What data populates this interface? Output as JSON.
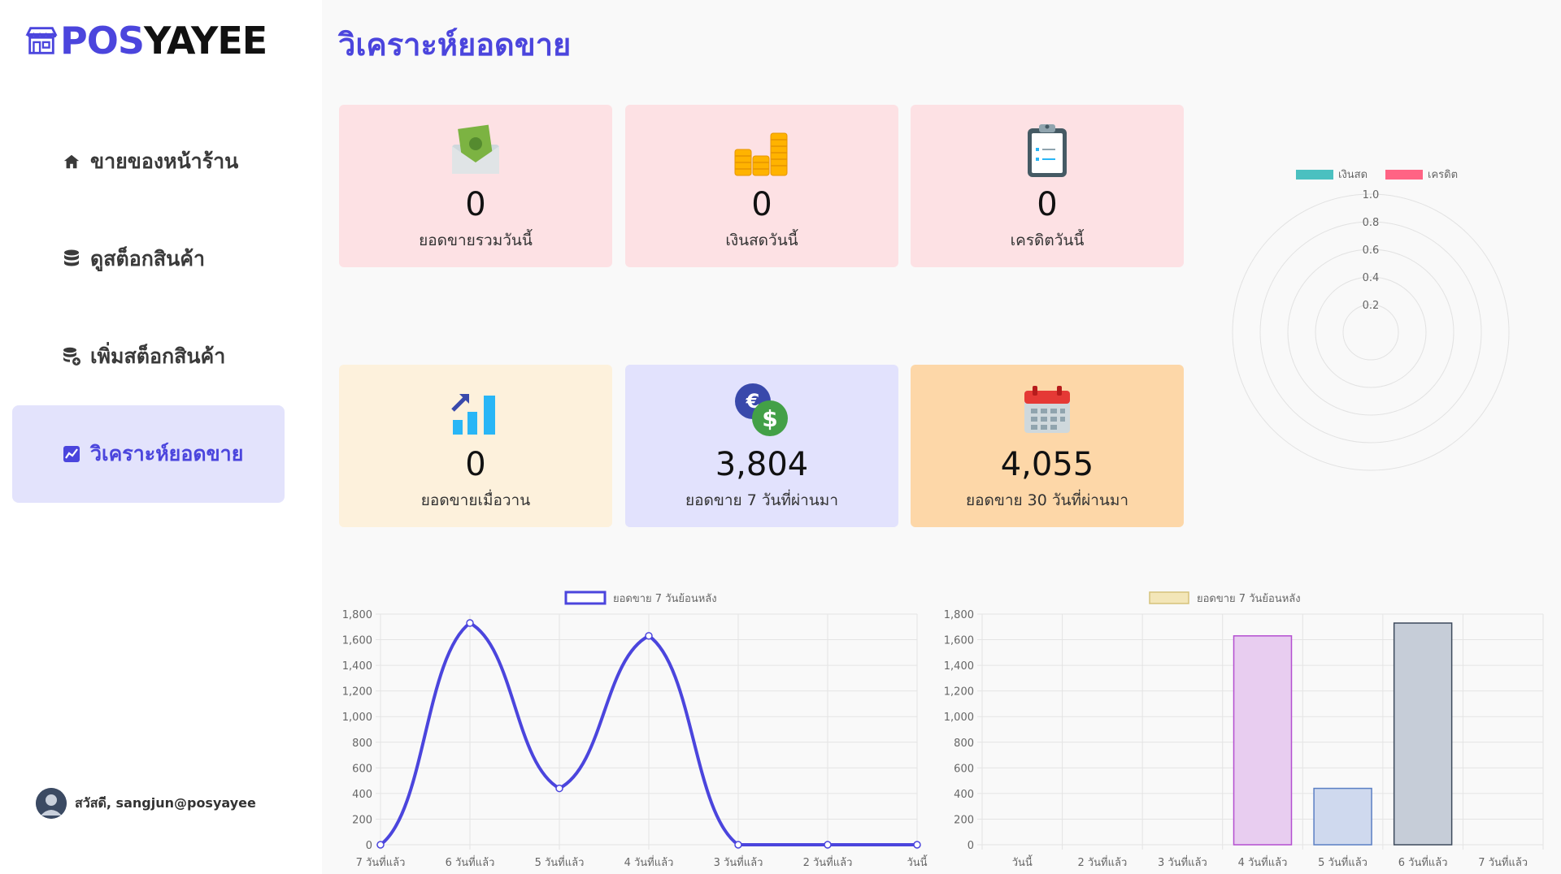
{
  "brand": {
    "part1": "POS",
    "part2": "YAYEE"
  },
  "nav": {
    "items": [
      {
        "label": "ขายของหน้าร้าน",
        "icon": "home-icon"
      },
      {
        "label": "ดูสต็อกสินค้า",
        "icon": "database-icon"
      },
      {
        "label": "เพิ่มสต็อกสินค้า",
        "icon": "database-add-icon"
      },
      {
        "label": "วิเคราะห์ยอดขาย",
        "icon": "chart-icon",
        "active": true
      }
    ]
  },
  "user": {
    "greeting": "สวัสดี, sangjun@posyayee"
  },
  "page": {
    "title": "วิเคราะห์ยอดขาย"
  },
  "cards": [
    {
      "value": "0",
      "label": "ยอดขายรวมวันนี้",
      "icon": "money-envelope-icon"
    },
    {
      "value": "0",
      "label": "เงินสดวันนี้",
      "icon": "coins-icon"
    },
    {
      "value": "0",
      "label": "เครดิตวันนี้",
      "icon": "clipboard-icon"
    },
    {
      "value": "0",
      "label": "ยอดขายเมื่อวาน",
      "icon": "bar-growth-icon"
    },
    {
      "value": "3,804",
      "label": "ยอดขาย 7 วันที่ผ่านมา",
      "icon": "currency-exchange-icon"
    },
    {
      "value": "4,055",
      "label": "ยอดขาย 30 วันที่ผ่านมา",
      "icon": "calendar-icon"
    }
  ],
  "colors": {
    "accent": "#4b45dd",
    "line": "#4b45dd",
    "radar_cash": "#4bc0c0",
    "radar_credit": "#ff6384"
  },
  "chart_data": [
    {
      "type": "radar",
      "legend": [
        "เงินสด",
        "เครดิต"
      ],
      "rlim": [
        0,
        1.0
      ],
      "ticks": [
        "0.2",
        "0.4",
        "0.6",
        "0.8",
        "1.0"
      ],
      "series": [
        {
          "name": "เงินสด",
          "values": []
        },
        {
          "name": "เครดิต",
          "values": []
        }
      ]
    },
    {
      "type": "line",
      "legend": "ยอดขาย 7 วันย้อนหลัง",
      "categories": [
        "7 วันที่แล้ว",
        "6 วันที่แล้ว",
        "5 วันที่แล้ว",
        "4 วันที่แล้ว",
        "3 วันที่แล้ว",
        "2 วันที่แล้ว",
        "วันนี้"
      ],
      "values": [
        0,
        1730,
        440,
        1630,
        0,
        0,
        0
      ],
      "ylim": [
        0,
        1800
      ],
      "yticks": [
        "0",
        "200",
        "400",
        "600",
        "800",
        "1,000",
        "1,200",
        "1,400",
        "1,600",
        "1,800"
      ]
    },
    {
      "type": "bar",
      "legend": "ยอดขาย 7 วันย้อนหลัง",
      "categories": [
        "วันนี้",
        "2 วันที่แล้ว",
        "3 วันที่แล้ว",
        "4 วันที่แล้ว",
        "5 วันที่แล้ว",
        "6 วันที่แล้ว",
        "7 วันที่แล้ว"
      ],
      "values": [
        0,
        0,
        0,
        1630,
        440,
        1730,
        0
      ],
      "ylim": [
        0,
        1800
      ],
      "yticks": [
        "0",
        "200",
        "400",
        "600",
        "800",
        "1,000",
        "1,200",
        "1,400",
        "1,600",
        "1,800"
      ],
      "bar_colors": [
        {
          "fill": "#f3e6b8",
          "stroke": "#d6c27a"
        },
        {
          "fill": "#f3e6b8",
          "stroke": "#d6c27a"
        },
        {
          "fill": "#f3e6b8",
          "stroke": "#d6c27a"
        },
        {
          "fill": "#e8cdf0",
          "stroke": "#b44fd0"
        },
        {
          "fill": "#cfd9ee",
          "stroke": "#5b7fc4"
        },
        {
          "fill": "#c6cdd8",
          "stroke": "#3d4a5c"
        },
        {
          "fill": "#f3e6b8",
          "stroke": "#d6c27a"
        }
      ]
    }
  ]
}
